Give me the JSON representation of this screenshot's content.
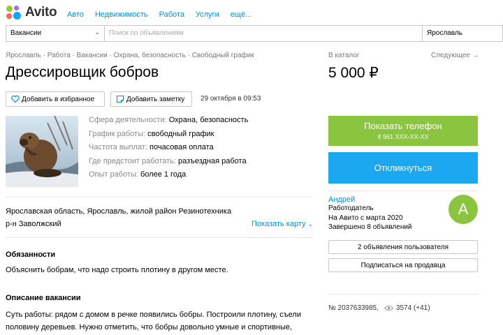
{
  "brand": {
    "name": "Avito"
  },
  "nav": [
    "Авто",
    "Недвижимость",
    "Работа",
    "Услуги",
    "ещё..."
  ],
  "search": {
    "category": "Вакансии",
    "placeholder": "Поиск по объявлениям",
    "city": "Ярославль"
  },
  "breadcrumb": "Ярославль · Работа · Вакансии · Охрана, безопасность · Свободный график",
  "listing": {
    "title": "Дрессировщик бобров",
    "catalog_label": "В каталог",
    "next_label": "Следующее →",
    "price": "5 000 ₽",
    "favorite_label": "Добавить в избранное",
    "note_label": "Добавить заметку",
    "date": "29 октября в 09:53"
  },
  "params": [
    {
      "key": "Сфера деятельности:",
      "value": "Охрана, безопасность"
    },
    {
      "key": "График работы:",
      "value": "свободный график"
    },
    {
      "key": "Частота выплат:",
      "value": "почасовая оплата"
    },
    {
      "key": "Где предстоит работать:",
      "value": "разъездная работа"
    },
    {
      "key": "Опыт работы:",
      "value": "более 1 года"
    }
  ],
  "address": {
    "line1": "Ярославская область, Ярославль, жилой район Резинотехника",
    "line2": "р-н Заволжский",
    "show_map": "Показать карту"
  },
  "duties": {
    "heading": "Обязанности",
    "text": "Объяснить бобрам, что надо строить плотину в другом месте."
  },
  "description": {
    "heading": "Описание вакансии",
    "text": "Суть работы: рядом с домом в речке появились бобры. Построили плотину, съели половину деревьев. Нужно отметить, что бобры довольно умные и спортивные,"
  },
  "contact": {
    "phone_label": "Показать телефон",
    "phone_masked": "8 961 XXX-XX-XX",
    "respond_label": "Откликнуться"
  },
  "seller": {
    "name": "Андрей",
    "role": "Работодатель",
    "since": "На Авито с марта 2020",
    "completed": "Завершено 8 объявлений",
    "avatar_letter": "А",
    "listings_button": "2 объявления пользователя",
    "subscribe_button": "Подписаться на продавца"
  },
  "ad_meta": {
    "number": "№ 2037633985,",
    "views": "3574 (+41)"
  },
  "colors": {
    "link": "#0091d9",
    "phone_button": "#8bc53f",
    "respond_button": "#1ba8f0",
    "avatar": "#8bc53f"
  }
}
